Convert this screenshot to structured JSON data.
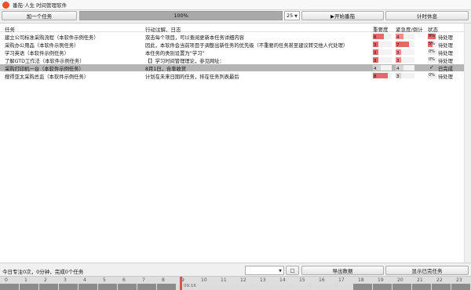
{
  "window": {
    "title": "番茄·人生 时间管理软件"
  },
  "toolbar": {
    "add_task": "加一个任务",
    "progress_percent": 100,
    "progress_label": "100%",
    "minutes": "25",
    "start": "▶开始番茄",
    "rest": "计时休息"
  },
  "table": {
    "headers": {
      "task": "任务",
      "notes": "行动注解、日志",
      "importance": "重要度",
      "urgency": "紧急度/倒计",
      "status": "状态"
    },
    "rows": [
      {
        "task": "建立公司标准采购流程（本软件示例任务）",
        "notes": "双击每个项目，可以查阅更新本任务详细内容",
        "importance": 6,
        "importance_color": "#e36a6a",
        "urgency": 4,
        "urgency_color": "#ef8b8b",
        "status_pct": "9%",
        "status_pct_value": 0.9,
        "status": "待处理",
        "selected": false,
        "done": false
      },
      {
        "task": "采购办公用品（本软件示例任务）",
        "notes": "因此，本软件会当前项目于调整出新任务的优先级（不重要的任务甚至建议转交他人代处理）",
        "importance": 3,
        "importance_color": "#e36a6a",
        "urgency": 7,
        "urgency_color": "#e36a6a",
        "status_pct": "5%",
        "status_pct_value": 0.5,
        "status": "待处理",
        "selected": false,
        "done": false
      },
      {
        "task": "学习英语（本软件示例任务）",
        "notes": "本任务的类别设置为“学习”",
        "importance": 3,
        "importance_color": "#e36a6a",
        "urgency": 3,
        "urgency_color": "#ef8b8b",
        "status_pct": "0%",
        "status_pct_value": 0.0,
        "status": "待处理",
        "selected": false,
        "done": false
      },
      {
        "task": "了解GTD工作法（本软件示例任务）",
        "notes": "【】学习时间管理理论，参见网址：",
        "importance": 3,
        "importance_color": "#e36a6a",
        "urgency": 3,
        "urgency_color": "#ef8b8b",
        "status_pct": "0%",
        "status_pct_value": 0.0,
        "status": "待处理",
        "selected": false,
        "done": false
      },
      {
        "task": "采购打印机一台（本软件示例任务）",
        "notes": "8月1日，合率收货",
        "importance": 4,
        "importance_color": "#d4d4d4",
        "urgency": 4,
        "urgency_color": "#d4d4d4",
        "status_pct": "",
        "status_pct_value": 0.0,
        "status": "已完成",
        "selected": true,
        "done": true
      },
      {
        "task": "搜得亚太采购总监（本软件示例任务）",
        "notes": "计划在未来日期的任务，排在任务列表最后",
        "importance": 8,
        "importance_color": "#e36a6a",
        "urgency": 3,
        "urgency_color": "#d4d4d4",
        "status_pct": "0%",
        "status_pct_value": 0.0,
        "status": "待处理",
        "selected": false,
        "done": false
      }
    ]
  },
  "footer": {
    "summary": "今日专注0次，0分钟，完成0个任务",
    "export": "导出数据",
    "show_done": "显示已完任务",
    "small_btn": "□"
  },
  "timeline": {
    "ticks": [
      "0",
      "1",
      "2",
      "3",
      "4",
      "5",
      "6",
      "7",
      "8",
      "9",
      "10",
      "11",
      "12",
      "13",
      "14",
      "15",
      "16",
      "17",
      "18",
      "19",
      "20",
      "21",
      "22",
      "23"
    ],
    "current_time": "09:16",
    "colors": {
      "night": "#8c8c8c",
      "day": "#dcdcdc",
      "cursor": "#d9534f"
    }
  }
}
